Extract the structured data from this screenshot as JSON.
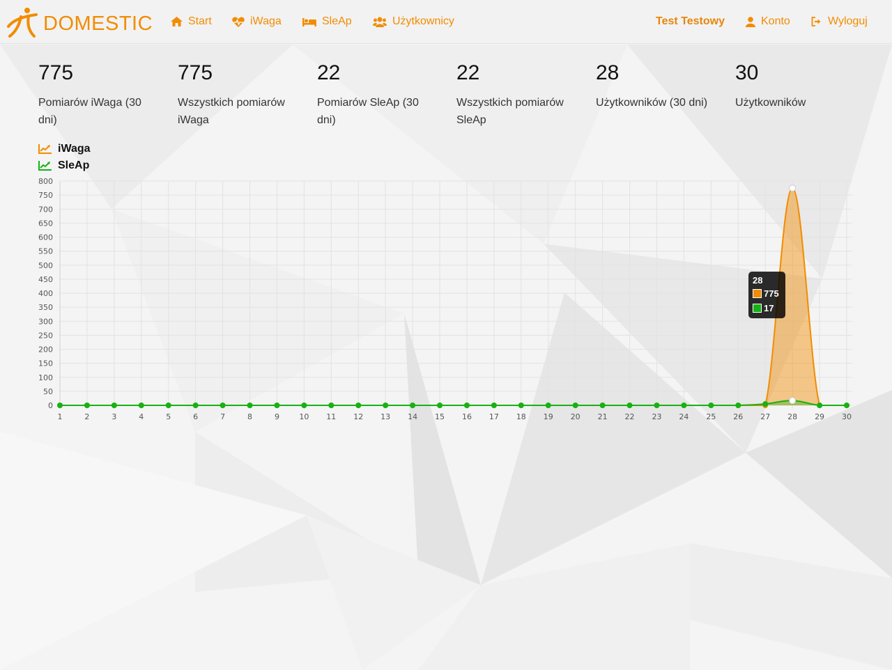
{
  "brand": {
    "name": "DOMESTIC"
  },
  "nav": {
    "start": "Start",
    "iwaga": "iWaga",
    "sleap": "SleAp",
    "users": "Użytkownicy",
    "user_name": "Test Testowy",
    "account": "Konto",
    "logout": "Wyloguj"
  },
  "stats": [
    {
      "value": "775",
      "label": "Pomiarów iWaga (30 dni)"
    },
    {
      "value": "775",
      "label": "Wszystkich pomiarów iWaga"
    },
    {
      "value": "22",
      "label": "Pomiarów SleAp (30 dni)"
    },
    {
      "value": "22",
      "label": "Wszystkich pomiarów SleAp"
    },
    {
      "value": "28",
      "label": "Użytkowników (30 dni)"
    },
    {
      "value": "30",
      "label": "Użytkowników"
    }
  ],
  "colors": {
    "accent": "#f28c00",
    "iwaga": "#f28c00",
    "sleap": "#14b314"
  },
  "chart_data": {
    "type": "area",
    "x": [
      1,
      2,
      3,
      4,
      5,
      6,
      7,
      8,
      9,
      10,
      11,
      12,
      13,
      14,
      15,
      16,
      17,
      18,
      19,
      20,
      21,
      22,
      23,
      24,
      25,
      26,
      27,
      28,
      29,
      30
    ],
    "ylim": [
      0,
      800
    ],
    "yticks": [
      0,
      50,
      100,
      150,
      200,
      250,
      300,
      350,
      400,
      450,
      500,
      550,
      600,
      650,
      700,
      750,
      800
    ],
    "grid": true,
    "legend_position": "top-left",
    "series": [
      {
        "name": "iWaga",
        "color": "#f28c00",
        "values": [
          0,
          0,
          0,
          0,
          0,
          0,
          0,
          0,
          0,
          0,
          0,
          0,
          0,
          0,
          0,
          0,
          0,
          0,
          0,
          0,
          0,
          0,
          0,
          0,
          0,
          0,
          0,
          775,
          0,
          0
        ]
      },
      {
        "name": "SleAp",
        "color": "#14b314",
        "values": [
          0,
          0,
          0,
          0,
          0,
          0,
          0,
          0,
          0,
          0,
          0,
          0,
          0,
          0,
          0,
          0,
          0,
          0,
          0,
          0,
          0,
          0,
          0,
          0,
          0,
          0,
          5,
          17,
          0,
          0
        ]
      }
    ],
    "tooltip": {
      "title": "28",
      "values": [
        "775",
        "17"
      ]
    }
  }
}
